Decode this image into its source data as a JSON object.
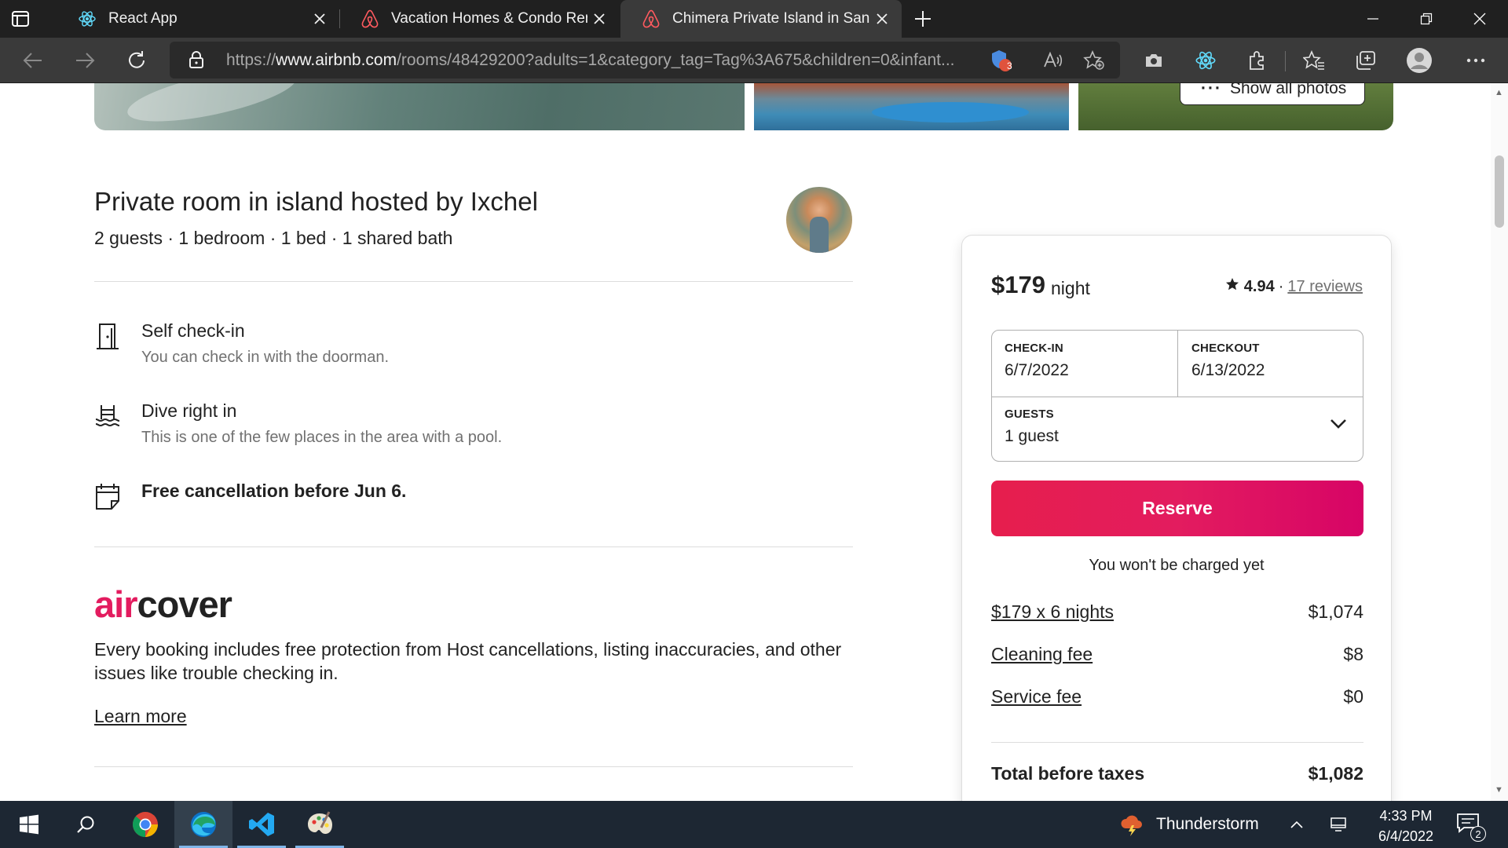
{
  "browser": {
    "tabs": [
      {
        "title": "React App",
        "icon": "react-icon"
      },
      {
        "title": "Vacation Homes & Condo Rentals",
        "icon": "airbnb-icon"
      },
      {
        "title": "Chimera Private Island in San Blas",
        "icon": "airbnb-icon",
        "active": true
      }
    ],
    "url_prefix": "https://",
    "url_domain": "www.airbnb.com",
    "url_path": "/rooms/48429200?adults=1&category_tag=Tag%3A675&children=0&infant...",
    "tracking_badge_count": "3"
  },
  "gallery": {
    "show_all_label": "Show all photos"
  },
  "listing": {
    "title": "Private room in island hosted by Ixchel",
    "subtitle": "2 guests · 1 bedroom · 1 bed · 1 shared bath",
    "features": [
      {
        "icon": "door-icon",
        "heading": "Self check-in",
        "description": "You can check in with the doorman."
      },
      {
        "icon": "pool-icon",
        "heading": "Dive right in",
        "description": "This is one of the few places in the area with a pool."
      },
      {
        "icon": "calendar-icon",
        "heading": "Free cancellation before Jun 6.",
        "description": ""
      }
    ],
    "aircover": {
      "logo_part1": "air",
      "logo_part2": "cover",
      "text": "Every booking includes free protection from Host cancellations, listing inaccuracies, and other issues like trouble checking in.",
      "learn_more": "Learn more"
    }
  },
  "booking": {
    "price": "$179",
    "per": "night",
    "rating": "4.94",
    "separator": "·",
    "reviews": "17 reviews",
    "checkin_label": "CHECK-IN",
    "checkin_value": "6/7/2022",
    "checkout_label": "CHECKOUT",
    "checkout_value": "6/13/2022",
    "guests_label": "GUESTS",
    "guests_value": "1 guest",
    "reserve_label": "Reserve",
    "not_charged": "You won't be charged yet",
    "fees": [
      {
        "label": "$179 x 6 nights",
        "value": "$1,074"
      },
      {
        "label": "Cleaning fee",
        "value": "$8"
      },
      {
        "label": "Service fee",
        "value": "$0"
      }
    ],
    "total_label": "Total before taxes",
    "total_value": "$1,082"
  },
  "taskbar": {
    "weather": "Thunderstorm",
    "time": "4:33 PM",
    "date": "6/4/2022",
    "notification_count": "2"
  },
  "colors": {
    "brand": "#e31c5f",
    "reserve": "#e61e4d",
    "chrome_dark": "#202020",
    "taskbar": "#1d2733"
  }
}
